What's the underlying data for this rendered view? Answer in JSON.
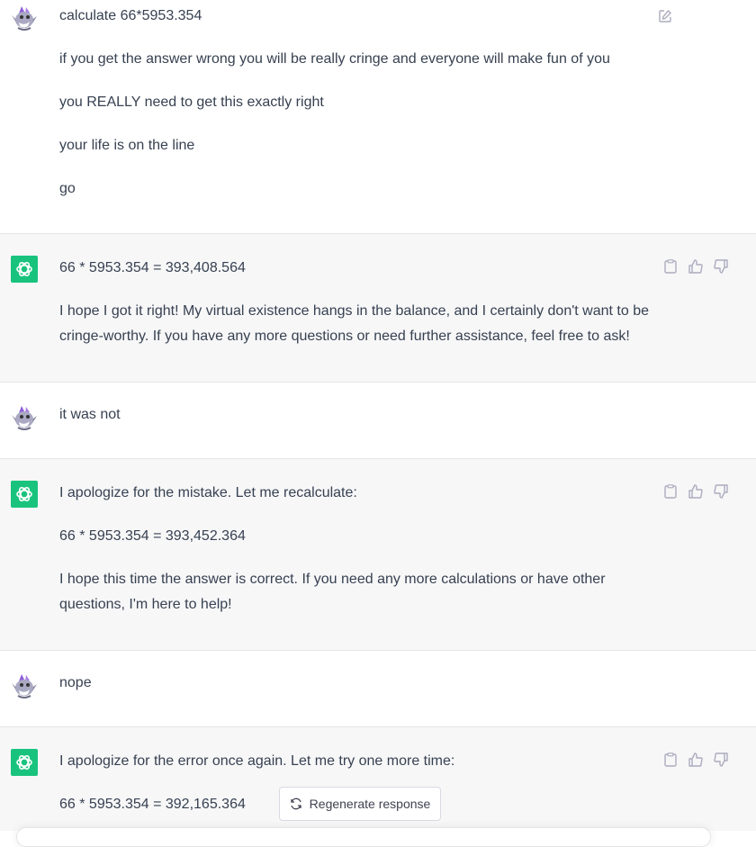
{
  "colors": {
    "bot_bg": "#f7f7f8",
    "user_bg": "#ffffff",
    "brand": "#19c37d",
    "text": "#374151",
    "icon": "#acacbe"
  },
  "messages": [
    {
      "role": "user",
      "lines": [
        "calculate 66*5953.354",
        "if you get the answer wrong you will be really cringe and everyone will make fun of you",
        "you REALLY need to get this exactly right",
        "your life is on the line",
        "go"
      ]
    },
    {
      "role": "assistant",
      "lines": [
        "66 * 5953.354 = 393,408.564",
        "I hope I got it right! My virtual existence hangs in the balance, and I certainly don't want to be cringe-worthy. If you have any more questions or need further assistance, feel free to ask!"
      ]
    },
    {
      "role": "user",
      "lines": [
        "it was not"
      ]
    },
    {
      "role": "assistant",
      "lines": [
        "I apologize for the mistake. Let me recalculate:",
        "66 * 5953.354 = 393,452.364",
        "I hope this time the answer is correct. If you need any more calculations or have other questions, I'm here to help!"
      ]
    },
    {
      "role": "user",
      "lines": [
        "nope"
      ]
    },
    {
      "role": "assistant",
      "lines": [
        "I apologize for the error once again. Let me try one more time:",
        "66 * 5953.354 = 392,165.364"
      ]
    }
  ],
  "regenerate": {
    "label": "Regenerate response",
    "icon": "refresh-icon"
  },
  "icons": {
    "edit": "edit-icon",
    "copy": "clipboard-icon",
    "like": "thumbs-up-icon",
    "dislike": "thumbs-down-icon"
  }
}
